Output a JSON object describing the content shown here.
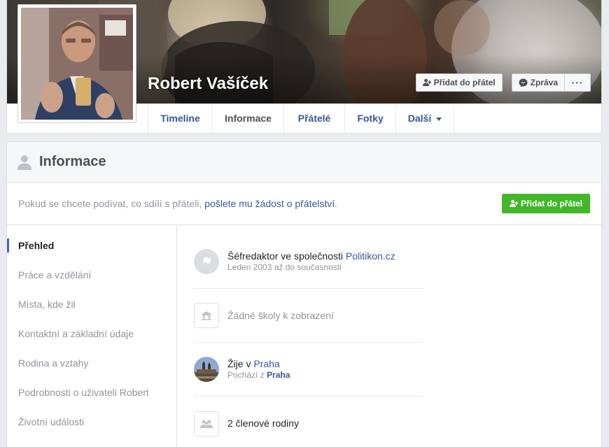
{
  "profile": {
    "name": "Robert Vašíček"
  },
  "cover_actions": {
    "add_friend_label": "Přidat do přátel",
    "message_label": "Zpráva",
    "more_label": "···"
  },
  "tabs": [
    {
      "label": "Timeline"
    },
    {
      "label": "Informace"
    },
    {
      "label": "Přátelé"
    },
    {
      "label": "Fotky"
    },
    {
      "label": "Další"
    }
  ],
  "info": {
    "title": "Informace",
    "request_text_before": "Pokud se chcete podívat, co sdílí s přáteli, ",
    "request_link": "pošlete mu žádost o přátelství",
    "request_text_after": ".",
    "add_friend_label": "Přidat do přátel"
  },
  "left_nav": [
    {
      "label": "Přehled"
    },
    {
      "label": "Práce a vzdělání"
    },
    {
      "label": "Místa, kde žil"
    },
    {
      "label": "Kontaktní a základní údaje"
    },
    {
      "label": "Rodina a vztahy"
    },
    {
      "label": "Podrobnosti o uživateli Robert"
    },
    {
      "label": "Životní události"
    }
  ],
  "overview": {
    "work": {
      "main_prefix": "Šéfredaktor ve společnosti ",
      "company": "Politikon.cz",
      "sub": "Leden 2003 až do současnosti"
    },
    "school": {
      "main": "Žádné školy k zobrazení"
    },
    "lives": {
      "main_prefix": "Žije v ",
      "city": "Praha",
      "sub_prefix": "Pochází z ",
      "hometown": "Praha"
    },
    "family": {
      "main": "2 členové rodiny"
    }
  },
  "colors": {
    "link": "#365899",
    "green": "#42b72a",
    "accent": "#4267b2"
  },
  "icons": [
    "person-plus-icon",
    "messenger-icon",
    "person-icon",
    "flag-icon",
    "school-icon",
    "family-icon"
  ]
}
